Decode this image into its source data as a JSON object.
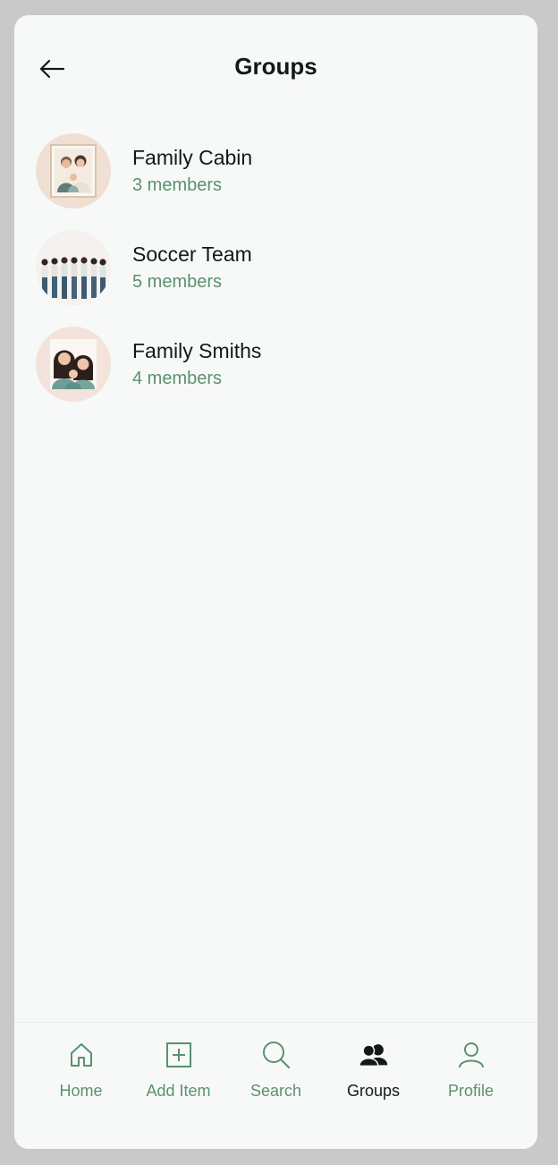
{
  "header": {
    "title": "Groups"
  },
  "groups": [
    {
      "name": "Family Cabin",
      "members": "3 members"
    },
    {
      "name": "Soccer Team",
      "members": "5 members"
    },
    {
      "name": "Family Smiths",
      "members": "4 members"
    }
  ],
  "nav": [
    {
      "label": "Home",
      "icon": "home-icon"
    },
    {
      "label": "Add Item",
      "icon": "plus-square-icon"
    },
    {
      "label": "Search",
      "icon": "search-icon"
    },
    {
      "label": "Groups",
      "icon": "groups-icon",
      "active": true
    },
    {
      "label": "Profile",
      "icon": "user-icon"
    }
  ],
  "colors": {
    "accent": "#5b9070",
    "text": "#121a16",
    "background": "#f7f9f8"
  }
}
